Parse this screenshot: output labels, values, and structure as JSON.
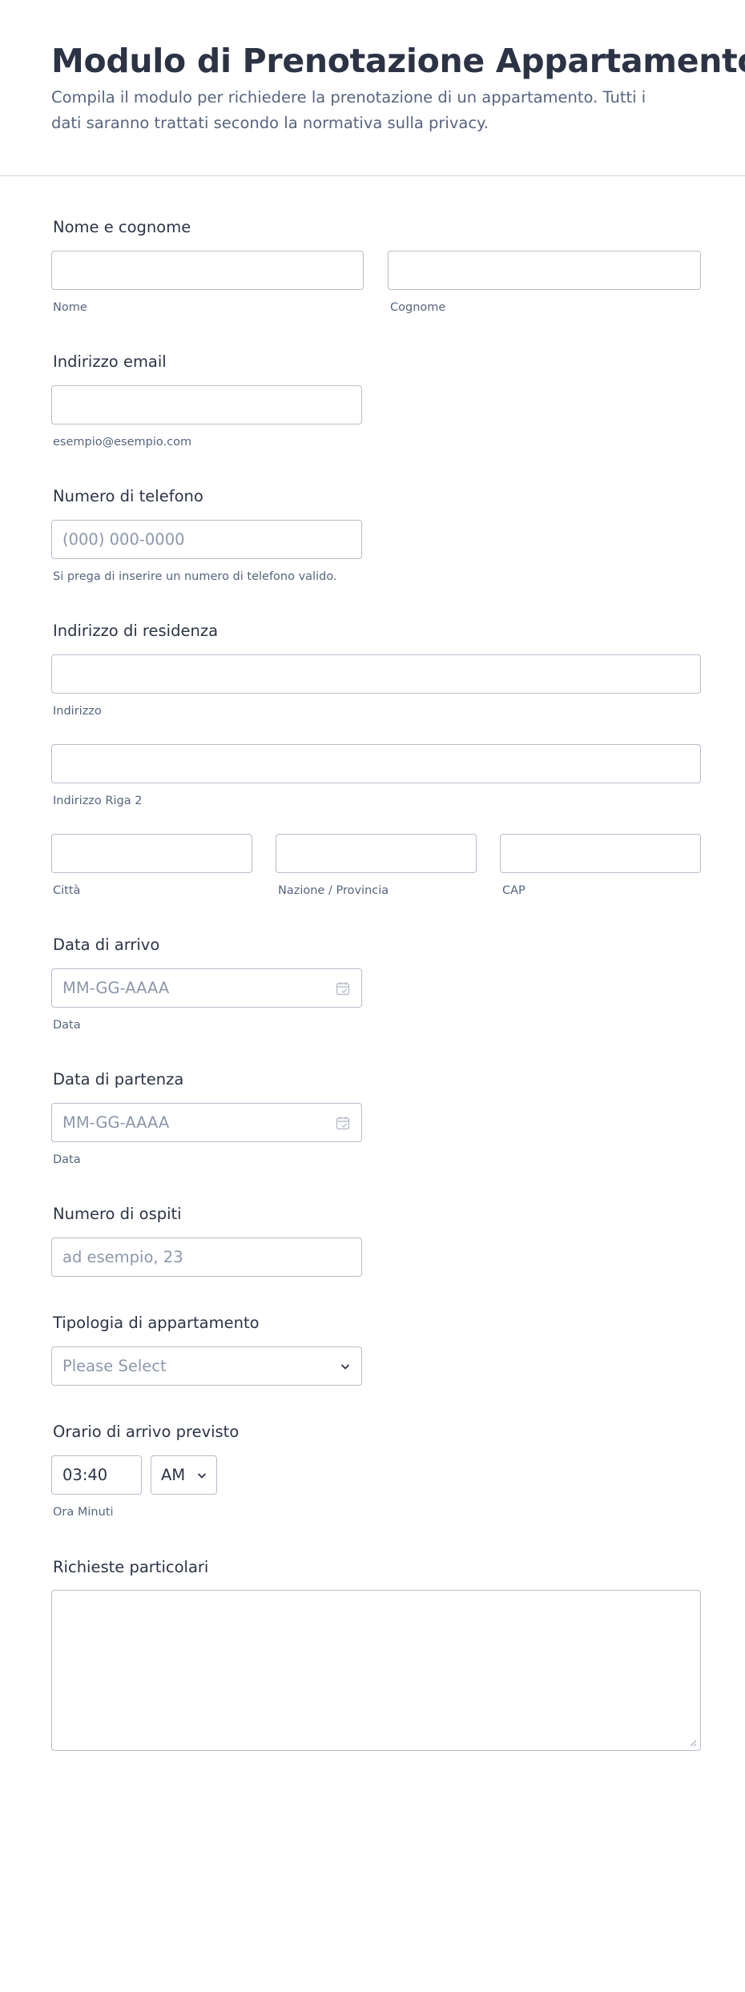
{
  "header": {
    "title": "Modulo di Prenotazione Appartamento",
    "subtitle": "Compila il modulo per richiedere la prenotazione di un appartamento. Tutti i dati saranno trattati secondo la normativa sulla privacy."
  },
  "name": {
    "label": "Nome e cognome",
    "first_sublabel": "Nome",
    "last_sublabel": "Cognome"
  },
  "email": {
    "label": "Indirizzo email",
    "sublabel": "esempio@esempio.com"
  },
  "phone": {
    "label": "Numero di telefono",
    "placeholder": "(000) 000-0000",
    "sublabel": "Si prega di inserire un numero di telefono valido."
  },
  "address": {
    "label": "Indirizzo di residenza",
    "line1_sublabel": "Indirizzo",
    "line2_sublabel": "Indirizzo Riga 2",
    "city_sublabel": "Città",
    "state_sublabel": "Nazione / Provincia",
    "zip_sublabel": "CAP"
  },
  "arrival_date": {
    "label": "Data di arrivo",
    "placeholder": "MM-GG-AAAA",
    "sublabel": "Data"
  },
  "departure_date": {
    "label": "Data di partenza",
    "placeholder": "MM-GG-AAAA",
    "sublabel": "Data"
  },
  "guests": {
    "label": "Numero di ospiti",
    "placeholder": "ad esempio, 23"
  },
  "apartment_type": {
    "label": "Tipologia di appartamento",
    "selected": "Please Select"
  },
  "arrival_time": {
    "label": "Orario di arrivo previsto",
    "time_value": "03:40",
    "ampm_value": "AM",
    "sublabel": "Ora Minuti"
  },
  "requests": {
    "label": "Richieste particolari"
  },
  "colors": {
    "text": "#2c3345",
    "muted": "#57647e",
    "placeholder": "#8d97aa",
    "border": "#b8bdc9"
  }
}
